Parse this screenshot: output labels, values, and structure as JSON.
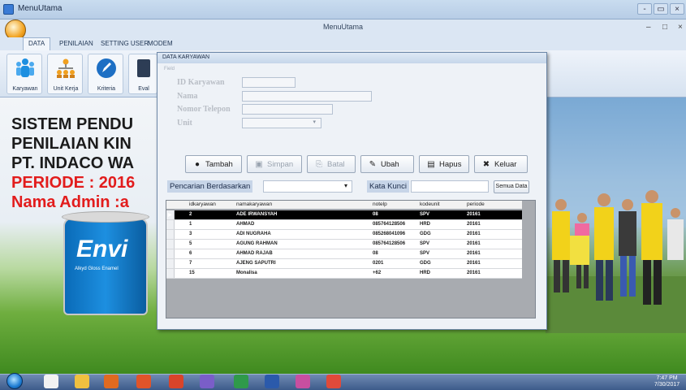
{
  "window": {
    "title": "MenuUtama",
    "doc_title": "MenuUtama",
    "minimize": "-",
    "maximize": "□",
    "close": "×",
    "restore": "▭",
    "ctrl_min": "–",
    "ctrl_max": "□",
    "ctrl_close": "×"
  },
  "ribbon": {
    "tabs": [
      "DATA",
      "PENILAIAN",
      "SETTING USER",
      "MODEM"
    ],
    "buttons": [
      "Karyawan",
      "Unit Kerja",
      "Kriteria",
      "Eval"
    ]
  },
  "background": {
    "lines": [
      "SISTEM PENDU",
      "PENILAIAN KIN",
      "PT. INDACO WA",
      "PERIODE : 2016",
      "Nama Admin :a"
    ],
    "brand": "Envi",
    "brand_sub": "Alkyd Gloss Enamel"
  },
  "dialog": {
    "title": "DATA KARYAWAN",
    "group_legend": "Field",
    "labels": {
      "id": "ID Karyawan",
      "nama": "Nama",
      "telepon": "Nomor Telepon",
      "unit": "Unit"
    },
    "buttons": {
      "tambah": "Tambah",
      "simpan": "Simpan",
      "batal": "Batal",
      "ubah": "Ubah",
      "hapus": "Hapus",
      "keluar": "Keluar"
    },
    "search_label": "Pencarian Berdasarkan",
    "keyword_label": "Kata Kunci",
    "semua_button": "Semua Data"
  },
  "grid": {
    "columns": [
      "idkaryawan",
      "namakaryawan",
      "notelp",
      "kodeunit",
      "periode"
    ],
    "rows": [
      [
        "2",
        "ADE IRWANSYAH",
        "08",
        "SPV",
        "20161"
      ],
      [
        "1",
        "AHMAD",
        "085764128506",
        "HRD",
        "20161"
      ],
      [
        "3",
        "ADI NUGRAHA",
        "085268041096",
        "GDG",
        "20161"
      ],
      [
        "5",
        "AGUNG RAHMAN",
        "085764128506",
        "SPV",
        "20161"
      ],
      [
        "6",
        "AHMAD RAJAB",
        "08",
        "SPV",
        "20161"
      ],
      [
        "7",
        "AJENG SAPUTRI",
        "0201",
        "GDG",
        "20161"
      ],
      [
        "15",
        "Monalisa",
        "+62",
        "HRD",
        "20161"
      ]
    ],
    "selected_marker": "▶"
  },
  "taskbar": {
    "time": "7:47 PM",
    "date": "7/30/2017"
  },
  "colors": {
    "accent": "#3a7bd5",
    "headline_red": "#e21c1c",
    "selected_row": "#000000"
  }
}
